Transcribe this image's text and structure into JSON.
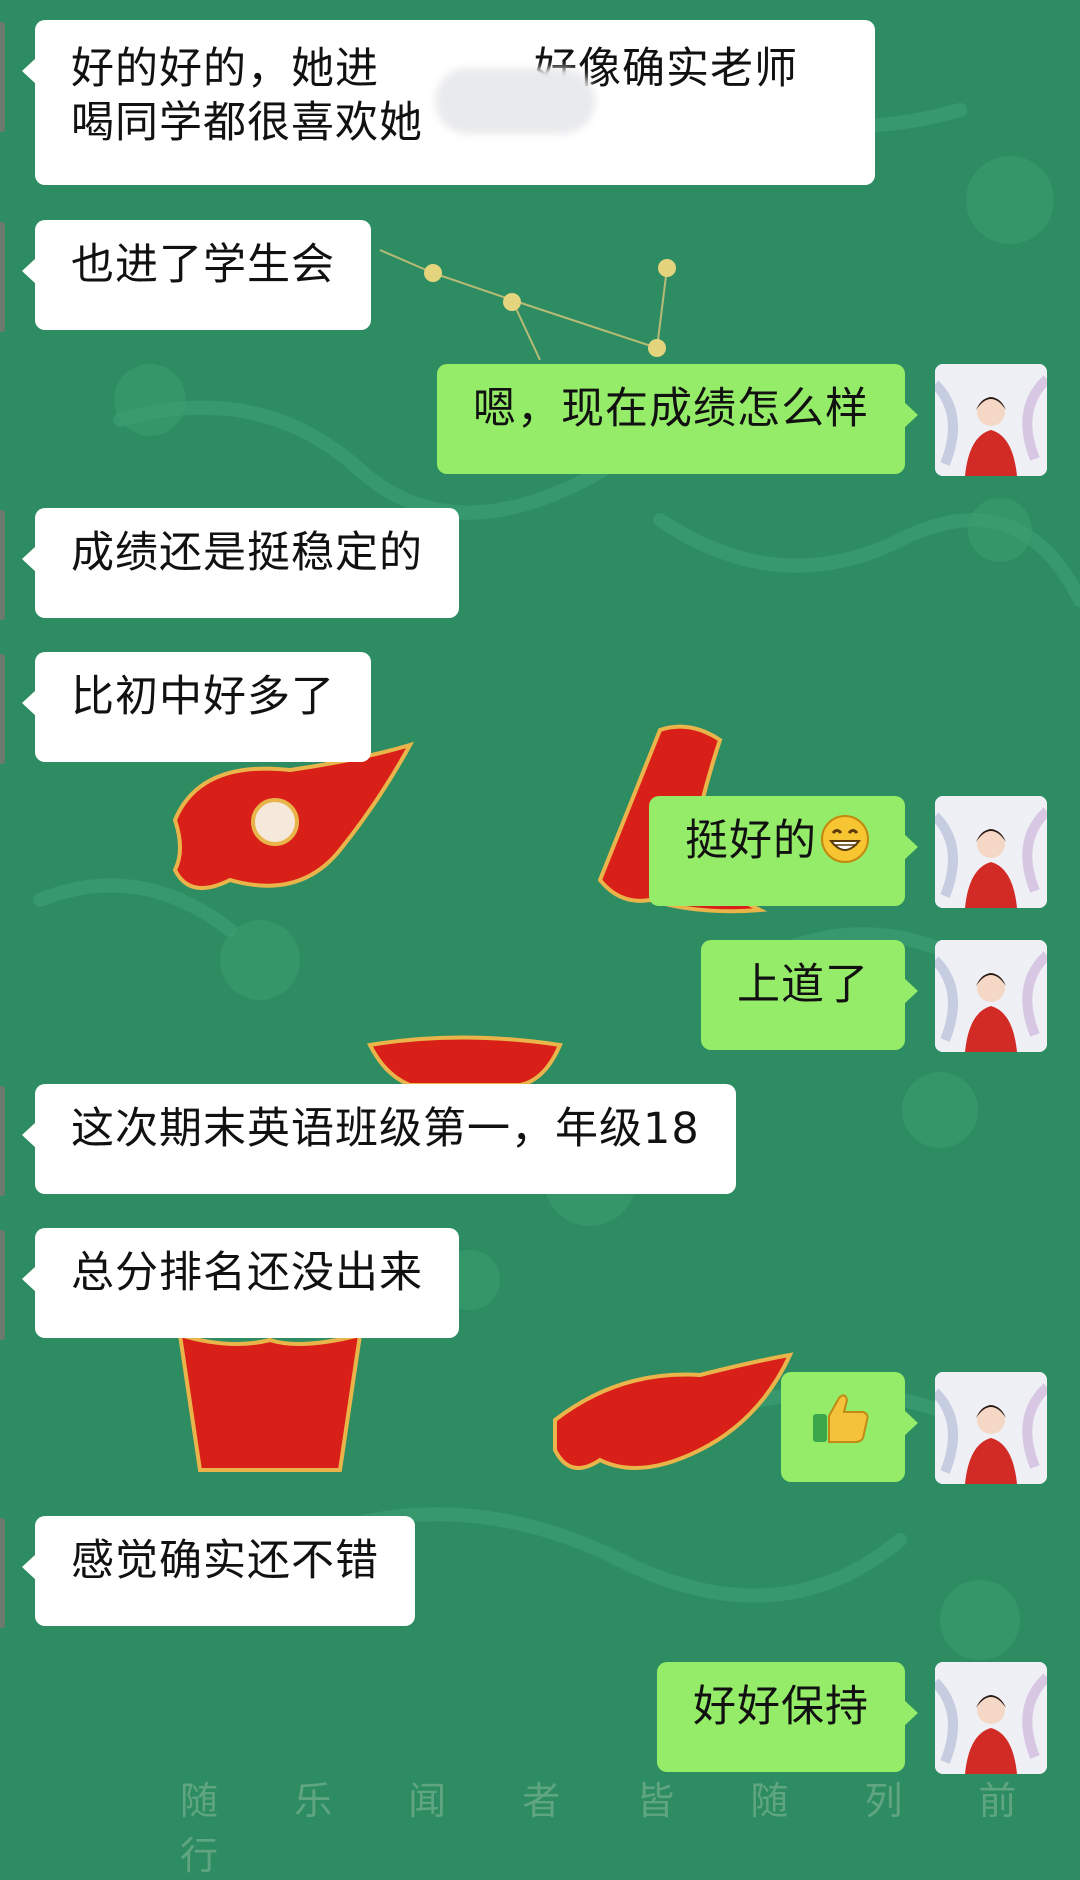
{
  "colors": {
    "background": "#2e8c62",
    "incoming_bubble": "#ffffff",
    "outgoing_bubble": "#95ec69",
    "emblem_red": "#d92018"
  },
  "messages": [
    {
      "side": "left",
      "text_before": "好的好的，她进",
      "redacted": true,
      "text_after": "好像确实老师",
      "line2": "喝同学都很喜欢她"
    },
    {
      "side": "left",
      "text": "也进了学生会"
    },
    {
      "side": "right",
      "text": "嗯，现在成绩怎么样"
    },
    {
      "side": "left",
      "text": "成绩还是挺稳定的"
    },
    {
      "side": "left",
      "text": "比初中好多了"
    },
    {
      "side": "right",
      "text": "挺好的",
      "emoji": "grinning-face-icon"
    },
    {
      "side": "right",
      "text": "上道了"
    },
    {
      "side": "left",
      "text": "这次期末英语班级第一，年级18"
    },
    {
      "side": "left",
      "text": "总分排名还没出来"
    },
    {
      "side": "right",
      "text": "",
      "emoji": "thumbs-up-icon"
    },
    {
      "side": "left",
      "text": "感觉确实还不错"
    },
    {
      "side": "right",
      "text": "好好保持"
    }
  ],
  "background_caption": "随 乐 闻 者 皆 随 列 前 行"
}
